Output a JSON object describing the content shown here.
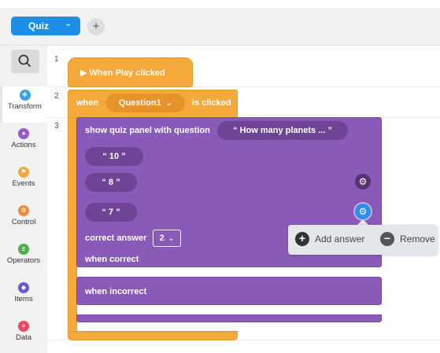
{
  "topbar": {
    "scene_label": "Quiz",
    "scene_chevron": "⌄",
    "add_label": "+"
  },
  "sidebar": {
    "search_icon": "search-icon",
    "categories": [
      {
        "label": "Transform",
        "icon": "transform-icon",
        "color": "#3aa0e8",
        "glyph": "✥"
      },
      {
        "label": "Actions",
        "icon": "actions-icon",
        "color": "#9b59c4",
        "glyph": "●"
      },
      {
        "label": "Events",
        "icon": "events-icon",
        "color": "#f6a93b",
        "glyph": "⚑"
      },
      {
        "label": "Control",
        "icon": "control-icon",
        "color": "#f28b3b",
        "glyph": "⚙"
      },
      {
        "label": "Operators",
        "icon": "operators-icon",
        "color": "#4caf50",
        "glyph": "±"
      },
      {
        "label": "Items",
        "icon": "items-icon",
        "color": "#6a5ad0",
        "glyph": "◆"
      },
      {
        "label": "Data",
        "icon": "data-icon",
        "color": "#e84a5f",
        "glyph": "≡"
      }
    ]
  },
  "workspace": {
    "line_numbers": [
      "1",
      "2",
      "3"
    ],
    "hat_block": {
      "label": "▶ When Play clicked"
    },
    "when_block": {
      "prefix": "when",
      "object": "Question1",
      "chevron": "⌄",
      "suffix": "is clicked"
    },
    "quiz_block": {
      "label": "show quiz panel with question",
      "question": "“  How many planets ...  ”",
      "answers": [
        "“  10  ”",
        "“  8  ”",
        "“  7  ”"
      ],
      "correct_label": "correct answer",
      "correct_value": "2",
      "correct_chevron": "⌄",
      "when_correct": "when correct",
      "when_incorrect": "when incorrect"
    }
  },
  "popup": {
    "add_label": "Add answer",
    "remove_label": "Remove",
    "add_glyph": "+",
    "remove_glyph": "−"
  },
  "colors": {
    "event_orange": "#f6a93b",
    "looks_purple": "#8a5ab8",
    "accent_blue": "#1e8fe6"
  }
}
